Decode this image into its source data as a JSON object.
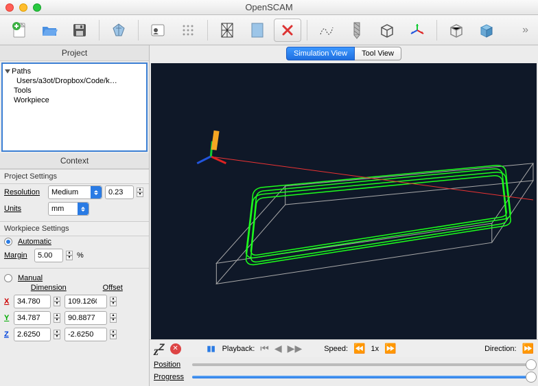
{
  "window": {
    "title": "OpenSCAM"
  },
  "project": {
    "pane_title": "Project",
    "root": "Paths",
    "root_child": "Users/a3ot/Dropbox/Code/k…",
    "item2": "Tools",
    "item3": "Workpiece"
  },
  "context": {
    "pane_title": "Context"
  },
  "projectSettings": {
    "heading": "Project Settings",
    "resolution_label": "Resolution",
    "resolution_value": "Medium",
    "resolution_num": "0.233",
    "units_label": "Units",
    "units_value": "mm"
  },
  "workpieceSettings": {
    "heading": "Workpiece Settings",
    "automatic_label": "Automatic",
    "margin_label": "Margin",
    "margin_value": "5.00",
    "margin_unit": "%",
    "manual_label": "Manual",
    "dim_head": "Dimension",
    "off_head": "Offset",
    "x_dim": "34.7800",
    "x_off": "109.1260",
    "y_dim": "34.7873",
    "y_off": "90.8877",
    "z_dim": "2.6250",
    "z_off": "-2.6250"
  },
  "tabs": {
    "sim": "Simulation View",
    "tool": "Tool View"
  },
  "playback": {
    "label": "Playback:",
    "speed_label": "Speed:",
    "speed_value": "1x",
    "direction_label": "Direction:"
  },
  "sliders": {
    "position": "Position",
    "progress": "Progress"
  }
}
